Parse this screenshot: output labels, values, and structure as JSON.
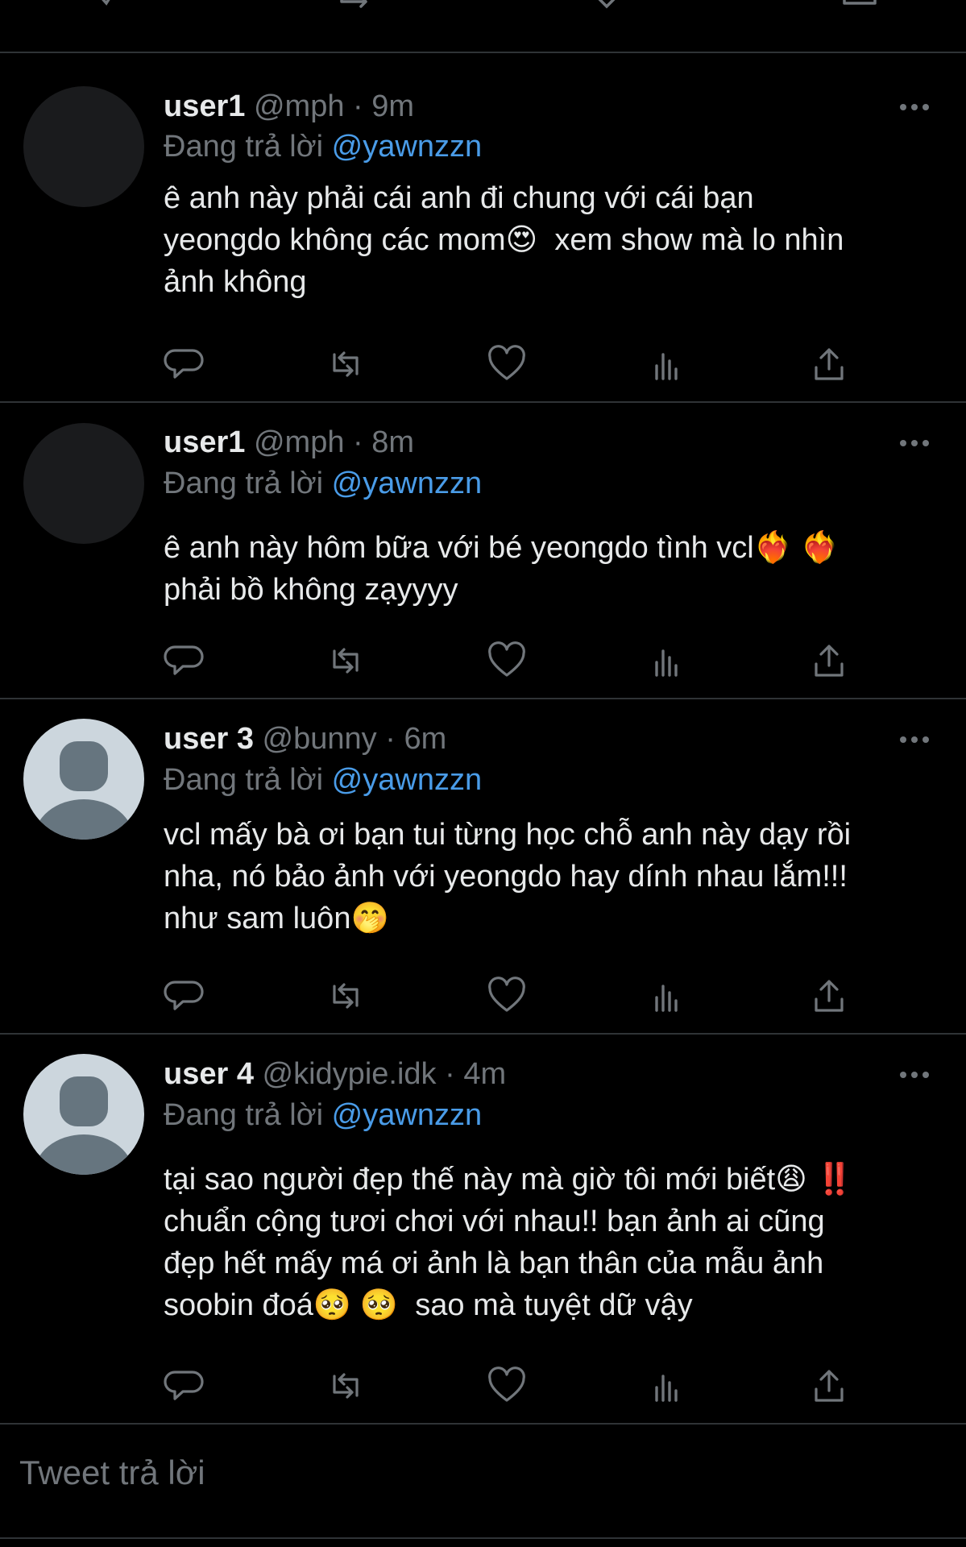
{
  "top_toolbar": {
    "icons": [
      "reply-icon",
      "retweet-icon",
      "like-icon",
      "share-icon"
    ]
  },
  "colors": {
    "background": "#000000",
    "text": "#e7e9ea",
    "muted": "#71767b",
    "accent": "#4a9ce8",
    "divider": "#2f3336"
  },
  "tweets": [
    {
      "name": "user1",
      "handle": "@mph",
      "dot": "·",
      "time": "9m",
      "reply_prefix": "Đang trả lời ",
      "reply_to": "@yawnzzn",
      "text": "ê anh này phải cái anh đi chung với cái bạn\nyeongdo không các mom😍  xem show mà lo nhìn\nảnh không",
      "avatar": "dark"
    },
    {
      "name": "user1",
      "handle": "@mph",
      "dot": "·",
      "time": "8m",
      "reply_prefix": "Đang trả lời ",
      "reply_to": "@yawnzzn",
      "text": "ê anh này hôm bữa với bé yeongdo tình vcl❤️‍🔥 ❤️‍🔥\nphải bồ không zạyyyy",
      "avatar": "dark"
    },
    {
      "name": "user 3",
      "handle": "@bunny",
      "dot": "·",
      "time": "6m",
      "reply_prefix": "Đang trả lời ",
      "reply_to": "@yawnzzn",
      "text": "vcl mấy bà ơi bạn tui từng học chỗ anh này dạy rồi\nnha, nó bảo ảnh với yeongdo hay dính nhau lắm!!!\nnhư sam luôn🤭",
      "avatar": "default"
    },
    {
      "name": "user 4",
      "handle": "@kidypie.idk",
      "dot": "·",
      "time": "4m",
      "reply_prefix": "Đang trả lời ",
      "reply_to": "@yawnzzn",
      "text": "tại sao người đẹp thế này mà giờ tôi mới biết😩 ‼️\nchuẩn cộng tươi chơi với nhau!! bạn ảnh ai cũng\nđẹp hết mấy má ơi ảnh là bạn thân của mẫu ảnh\nsoobin đoá🥺 🥺  sao mà tuyệt dữ vậy",
      "avatar": "default"
    }
  ],
  "tweet_actions": [
    "reply-icon",
    "retweet-icon",
    "like-icon",
    "views-icon",
    "share-icon"
  ],
  "reply_box": {
    "placeholder": "Tweet trả lời",
    "value": ""
  }
}
